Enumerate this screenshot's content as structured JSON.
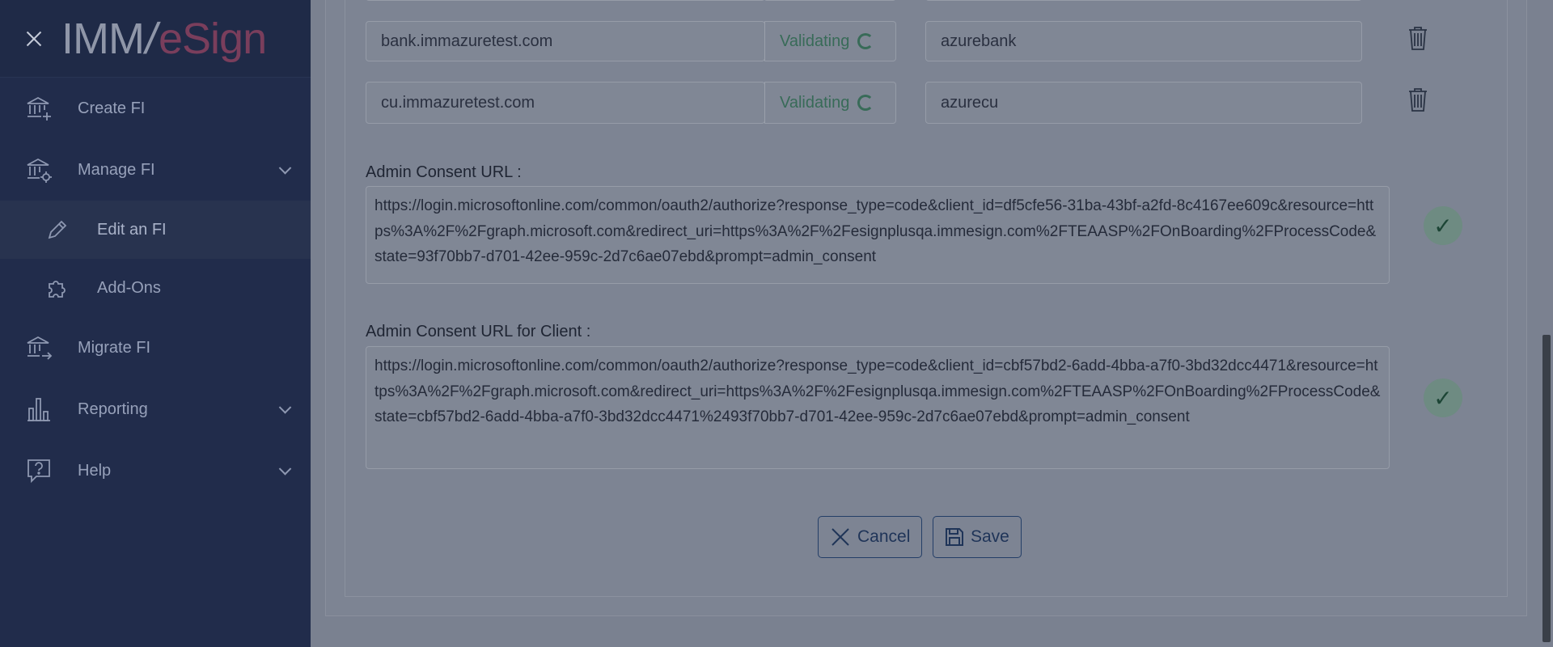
{
  "sidebar": {
    "logo": {
      "imm": "IMM",
      "slash": "/",
      "esign": "eSign"
    },
    "items": [
      {
        "label": "Create FI",
        "icon": "bank-add-icon"
      },
      {
        "label": "Manage FI",
        "icon": "bank-settings-icon"
      },
      {
        "label": "Edit an FI",
        "icon": "pencil-icon"
      },
      {
        "label": "Add-Ons",
        "icon": "puzzle-icon"
      },
      {
        "label": "Migrate FI",
        "icon": "bank-migrate-icon"
      },
      {
        "label": "Reporting",
        "icon": "bar-chart-icon"
      },
      {
        "label": "Help",
        "icon": "help-bubble-icon"
      }
    ]
  },
  "domains": [
    {
      "domain": "bank.immazuretest.com",
      "status": "Validating",
      "alias": "azurebank"
    },
    {
      "domain": "cu.immazuretest.com",
      "status": "Validating",
      "alias": "azurecu"
    }
  ],
  "consent": {
    "admin_label": "Admin Consent URL :",
    "admin_url": "https://login.microsoftonline.com/common/oauth2/authorize?response_type=code&client_id=df5cfe56-31ba-43bf-a2fd-8c4167ee609c&resource=https%3A%2F%2Fgraph.microsoft.com&redirect_uri=https%3A%2F%2Fesignplusqa.immesign.com%2FTEAASP%2FOnBoarding%2FProcessCode&state=93f70bb7-d701-42ee-959c-2d7c6ae07ebd&prompt=admin_consent",
    "client_label": "Admin Consent URL for Client :",
    "client_url": "https://login.microsoftonline.com/common/oauth2/authorize?response_type=code&client_id=cbf57bd2-6add-4bba-a7f0-3bd32dcc4471&resource=https%3A%2F%2Fgraph.microsoft.com&redirect_uri=https%3A%2F%2Fesignplusqa.immesign.com%2FTEAASP%2FOnBoarding%2FProcessCode&state=cbf57bd2-6add-4bba-a7f0-3bd32dcc4471%2493f70bb7-d701-42ee-959c-2d7c6ae07ebd&prompt=admin_consent"
  },
  "actions": {
    "cancel": "Cancel",
    "save": "Save"
  },
  "colors": {
    "sidebar_bg": "#212c4b",
    "validating": "#386b58",
    "button_border": "#233e67"
  }
}
